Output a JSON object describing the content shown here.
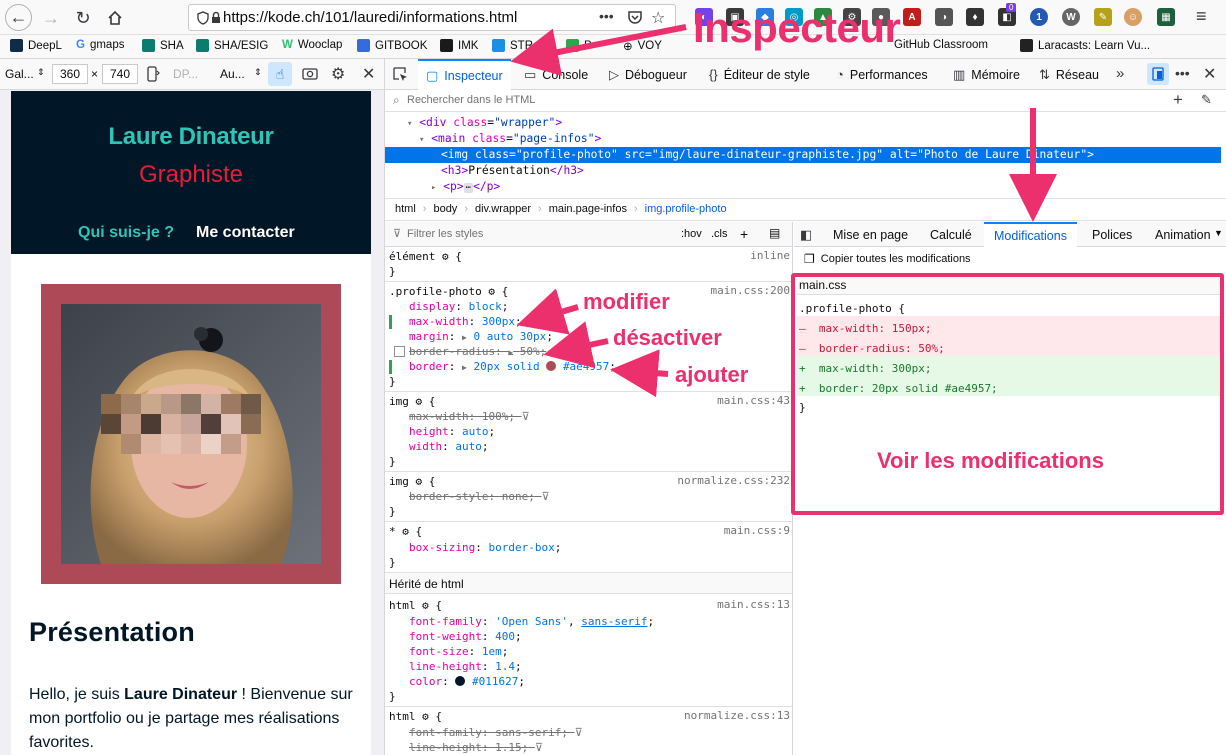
{
  "browser": {
    "url": "https://kode.ch/101/lauredi/informations.html",
    "url_host": "kode.ch",
    "url_scheme": "https://",
    "url_path": "/101/lauredi/informations.html",
    "more_icon": "•••",
    "ext_badge": "0",
    "bookmarks": [
      {
        "label": "DeepL",
        "color": "#0f2b46"
      },
      {
        "label": "gmaps",
        "color": "#4285f4"
      },
      {
        "label": "SHA",
        "color": "#0a7d6f"
      },
      {
        "label": "SHA/ESIG",
        "color": "#0a7d6f"
      },
      {
        "label": "Wooclap",
        "color": "#2fbf71"
      },
      {
        "label": "GITBOOK",
        "color": "#346ddb"
      },
      {
        "label": "IMK",
        "color": "#1a1a1a"
      },
      {
        "label": "STR",
        "color": "#1d8fe1"
      },
      {
        "label": "P",
        "color": "#2ea44f"
      },
      {
        "label": "VOY",
        "color": "#555555"
      },
      {
        "label": "GitHub Classroom",
        "color": "#444444"
      },
      {
        "label": "Laracasts: Learn Vu...",
        "color": "#222222"
      }
    ]
  },
  "rdm": {
    "device": "Gal...",
    "width": "360",
    "times": "×",
    "height": "740",
    "dpr": "DP...",
    "throttle": "Au..."
  },
  "devtools": {
    "tabs": [
      {
        "label": "Inspecteur",
        "icon": "inspector-icon",
        "active": true
      },
      {
        "label": "Console",
        "icon": "console-icon"
      },
      {
        "label": "Débogueur",
        "icon": "debugger-icon"
      },
      {
        "label": "Éditeur de style",
        "icon": "style-editor-icon"
      },
      {
        "label": "Performances",
        "icon": "performance-icon"
      },
      {
        "label": "Mémoire",
        "icon": "memory-icon"
      },
      {
        "label": "Réseau",
        "icon": "network-icon"
      }
    ],
    "search_placeholder": "Rechercher dans le HTML",
    "markup": {
      "l1_tag": "<div",
      "l1_attr": "class",
      "l1_val": "\"wrapper\"",
      "l1_end": ">",
      "l2_tag": "<main",
      "l2_attr": "class",
      "l2_val": "\"page-infos\"",
      "l2_end": ">",
      "l3": "<img class=\"profile-photo\" src=\"img/laure-dinateur-graphiste.jpg\" alt=\"Photo de Laure Dinateur\">",
      "l4_open": "<h3>",
      "l4_text": "Présentation",
      "l4_close": "</h3>",
      "l5_open": "<p>",
      "l5_dots": "⋯",
      "l5_close": "</p>"
    },
    "breadcrumbs": [
      "html",
      "body",
      "div.wrapper",
      "main.page-infos",
      "img.profile-photo"
    ],
    "filter_placeholder": "Filtrer les styles",
    "hov": ":hov",
    "cls": ".cls",
    "inline_label": "inline",
    "element_label": "élément",
    "inherited_label": "Hérité de html",
    "side_tabs": [
      "Mise en page",
      "Calculé",
      "Modifications",
      "Polices",
      "Animation"
    ],
    "copy_all_label": "Copier toutes les modifications",
    "changes_file": "main.css",
    "changes_selector": ".profile-photo {",
    "changes": [
      {
        "sign": "–",
        "text": "max-width: 150px;",
        "type": "removed"
      },
      {
        "sign": "–",
        "text": "border-radius: 50%;",
        "type": "removed"
      },
      {
        "sign": "+",
        "text": "max-width: 300px;",
        "type": "added"
      },
      {
        "sign": "+",
        "text": "border: 20px solid #ae4957;",
        "type": "added"
      }
    ],
    "changes_close": "}"
  },
  "rules": {
    "profile_selector": ".profile-photo",
    "profile_src": "main.css:200",
    "p_display_n": "display",
    "p_display_v": "block",
    "p_maxw_n": "max-width",
    "p_maxw_v": "300px",
    "p_margin_n": "margin",
    "p_margin_v": "0 auto 30px",
    "p_radius_n": "border-radius",
    "p_radius_v": "50%",
    "p_border_n": "border",
    "p_border_v1": "20px solid",
    "p_border_v2": "#ae4957",
    "img1_src": "main.css:43",
    "img1_maxw": "max-width: 100%;",
    "img1_h_n": "height",
    "img1_h_v": "auto",
    "img1_w_n": "width",
    "img1_w_v": "auto",
    "img2_src": "normalize.css:232",
    "img2_bs": "border-style: none;",
    "star_src": "main.css:9",
    "star_bs_n": "box-sizing",
    "star_bs_v": "border-box",
    "html1_src": "main.css:13",
    "html1_ff_n": "font-family",
    "html1_ff_v1": "'Open Sans'",
    "html1_ff_v2": "sans-serif",
    "html1_fw_n": "font-weight",
    "html1_fw_v": "400",
    "html1_fs_n": "font-size",
    "html1_fs_v": "1em",
    "html1_lh_n": "line-height",
    "html1_lh_v": "1.4",
    "html1_c_n": "color",
    "html1_c_v": "#011627",
    "html2_src": "normalize.css:13",
    "html2_ff": "font-family: sans-serif;",
    "html2_lh": "line-height: 1.15;"
  },
  "site": {
    "name": "Laure Dinateur",
    "role": "Graphiste",
    "nav": [
      "Qui suis-je ?",
      "Me contacter"
    ],
    "h3": "Présentation",
    "intro_1": "Hello, je suis ",
    "intro_bold": "Laure Dinateur",
    "intro_2": " ! Bienvenue sur mon portfolio ou je partage mes réalisations favorites."
  },
  "annotations": {
    "inspecteur": "Inspecteur",
    "modifier": "modifier",
    "desactiver": "désactiver",
    "ajouter": "ajouter",
    "voir": "Voir les modifications"
  },
  "colors": {
    "accent": "#ec2f6d",
    "photo_border": "#ae4957",
    "header_bg": "#011627",
    "teal": "#2ec4b6",
    "red": "#e71d36",
    "selection": "#0074e8"
  }
}
